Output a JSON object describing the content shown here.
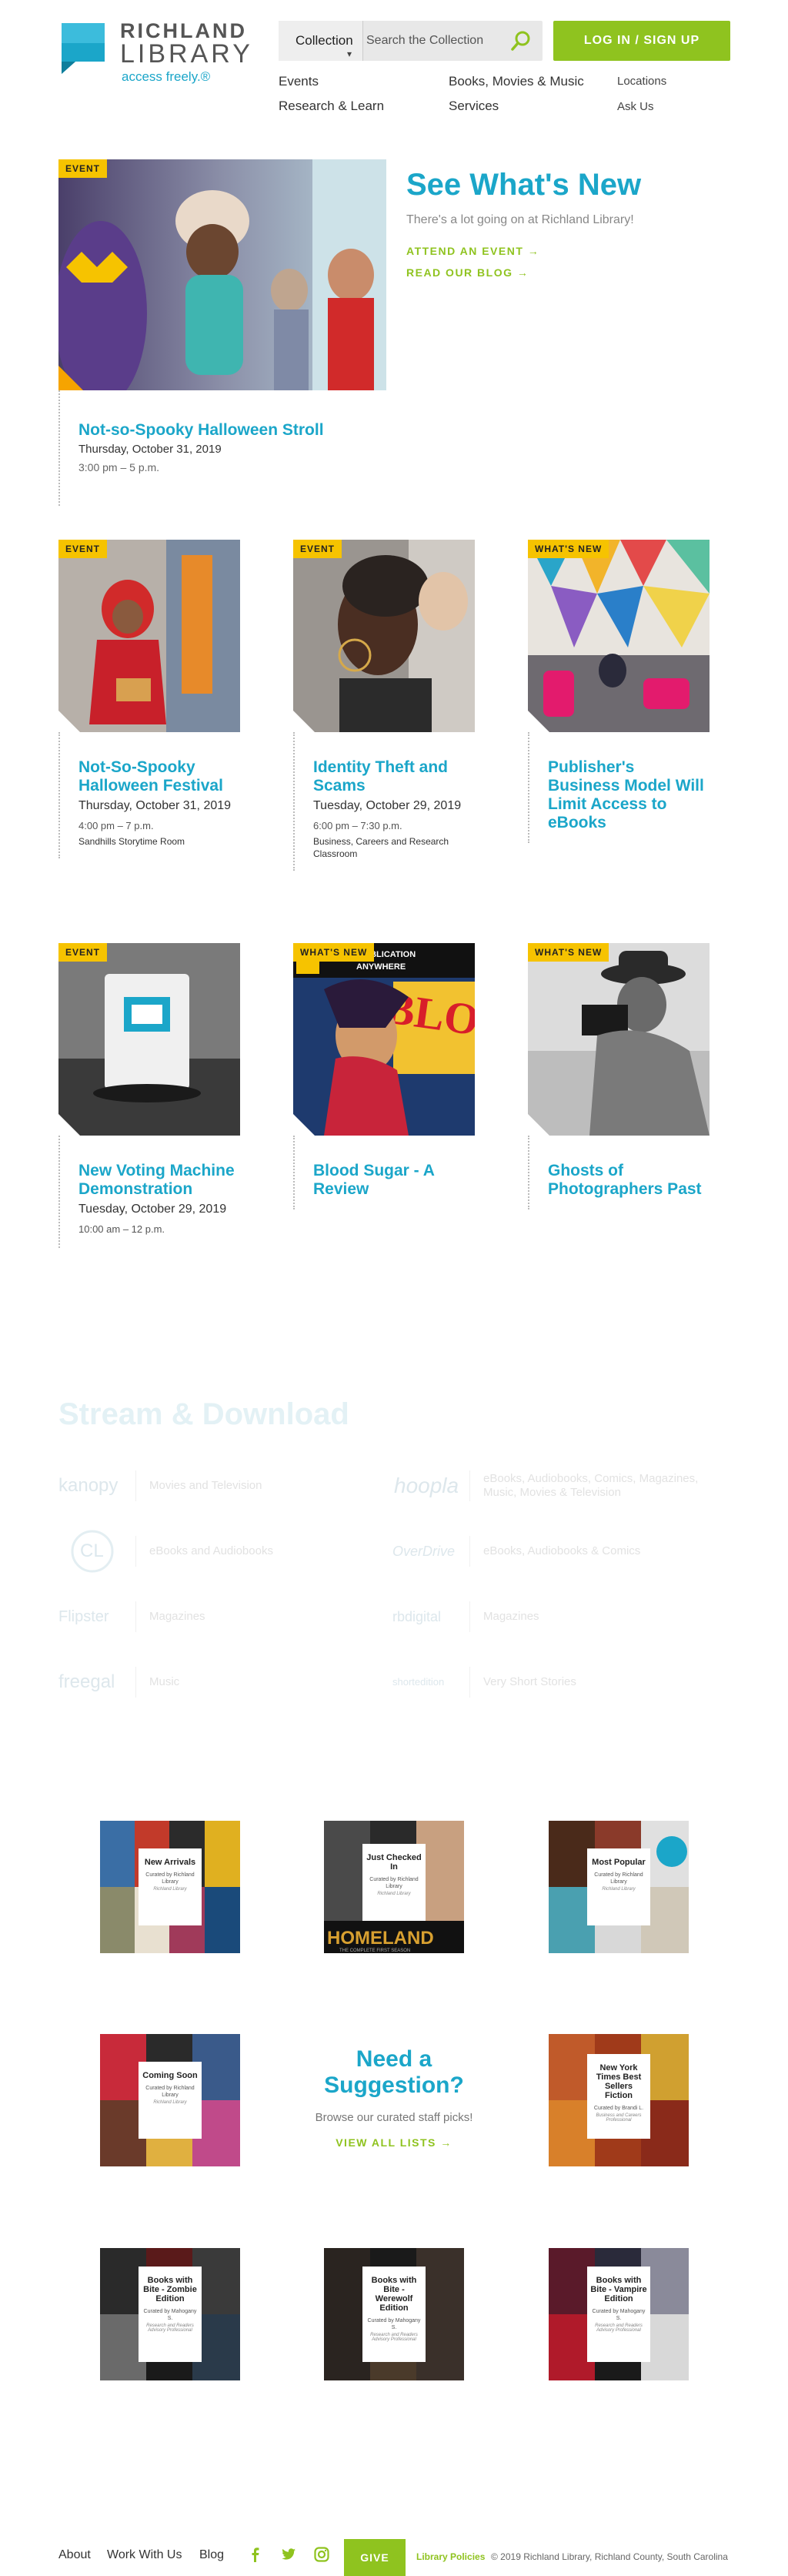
{
  "header": {
    "logo_line1": "RICHLAND",
    "logo_line2": "LIBRARY",
    "logo_tagline": "access freely.®",
    "search_scope": "Collection",
    "search_placeholder": "Search the Collection",
    "login_label": "LOG IN / SIGN UP",
    "nav": [
      {
        "label": "Events"
      },
      {
        "label": "Books, Movies & Music"
      },
      {
        "label": "Locations"
      },
      {
        "label": "Research & Learn"
      },
      {
        "label": "Services"
      },
      {
        "label": "Ask Us"
      }
    ]
  },
  "hero": {
    "badge": "EVENT",
    "title": "See What's New",
    "subtitle": "There's a lot going on at Richland Library!",
    "link1": "ATTEND AN EVENT →",
    "link2": "READ OUR BLOG →",
    "card_title": "Not-so-Spooky Halloween Stroll",
    "card_date": "Thursday, October 31, 2019",
    "card_time": "3:00 pm – 5 p.m."
  },
  "cards": [
    {
      "badge": "EVENT",
      "title": "Not-So-Spooky Halloween Festival",
      "date": "Thursday, October 31, 2019",
      "time": "4:00 pm – 7 p.m.",
      "location": "Sandhills Storytime Room"
    },
    {
      "badge": "EVENT",
      "title": "Identity Theft and Scams",
      "date": "Tuesday, October 29, 2019",
      "time": "6:00 pm – 7:30 p.m.",
      "location": "Business, Careers and Research Classroom"
    },
    {
      "badge": "WHAT'S NEW",
      "title": "Publisher's Business Model Will Limit Access to eBooks",
      "date": "",
      "time": "",
      "location": ""
    },
    {
      "badge": "EVENT",
      "title": "New Voting Machine Demonstration",
      "date": "Tuesday, October 29, 2019",
      "time": "10:00 am – 12 p.m.",
      "location": ""
    },
    {
      "badge": "WHAT'S NEW",
      "title": "Blood Sugar - A Review",
      "date": "",
      "time": "",
      "location": ""
    },
    {
      "badge": "WHAT'S NEW",
      "title": "Ghosts of Photographers Past",
      "date": "",
      "time": "",
      "location": ""
    }
  ],
  "book_cover": {
    "line1": "FIRST PUBLICATION",
    "line2": "ANYWHERE",
    "title_art": "BLOOD SUG"
  },
  "stream": {
    "title": "Stream & Download",
    "services": [
      {
        "logo": "kanopy",
        "desc": "Movies and Television"
      },
      {
        "logo": "hoopla",
        "desc": "eBooks, Audiobooks, Comics, Magazines, Music, Movies & Television"
      },
      {
        "logo": "CL",
        "desc": "eBooks and Audiobooks"
      },
      {
        "logo": "OverDrive",
        "desc": "eBooks, Audiobooks & Comics"
      },
      {
        "logo": "Flipster",
        "desc": "Magazines"
      },
      {
        "logo": "rbdigital",
        "desc": "Magazines"
      },
      {
        "logo": "freegal",
        "desc": "Music"
      },
      {
        "logo": "shortedition",
        "desc": "Very Short Stories"
      }
    ]
  },
  "lists": {
    "suggestion_title": "Need a Suggestion?",
    "suggestion_sub": "Browse our curated staff picks!",
    "suggestion_link": "VIEW ALL LISTS →",
    "tiles": [
      {
        "name": "New Arrivals",
        "curator": "Curated by Richland Library",
        "org": "Richland Library"
      },
      {
        "name": "Just Checked In",
        "curator": "Curated by Richland Library",
        "org": "Richland Library"
      },
      {
        "name": "Most Popular",
        "curator": "Curated by Richland Library",
        "org": "Richland Library"
      },
      {
        "name": "Coming Soon",
        "curator": "Curated by Richland Library",
        "org": "Richland Library"
      },
      {
        "name": "New York Times Best Sellers Fiction",
        "curator": "Curated by Brandi L.",
        "org": "Business and Careers Professional"
      },
      {
        "name": "Books with Bite - Zombie Edition",
        "curator": "Curated by Mahogany S.",
        "org": "Research and Readers Advisory Professional"
      },
      {
        "name": "Books with Bite - Werewolf Edition",
        "curator": "Curated by Mahogany S.",
        "org": "Research and Readers Advisory Professional"
      },
      {
        "name": "Books with Bite - Vampire Edition",
        "curator": "Curated by Mahogany S.",
        "org": "Research and Readers Advisory Professional"
      }
    ],
    "homeland_art": "HOMELAND",
    "homeland_sub": "THE COMPLETE FIRST SEASON"
  },
  "footer": {
    "links": [
      "About",
      "Work With Us",
      "Blog"
    ],
    "give": "GIVE",
    "policies": "Library Policies",
    "copyright": "© 2019 Richland Library, Richland County, South Carolina"
  }
}
